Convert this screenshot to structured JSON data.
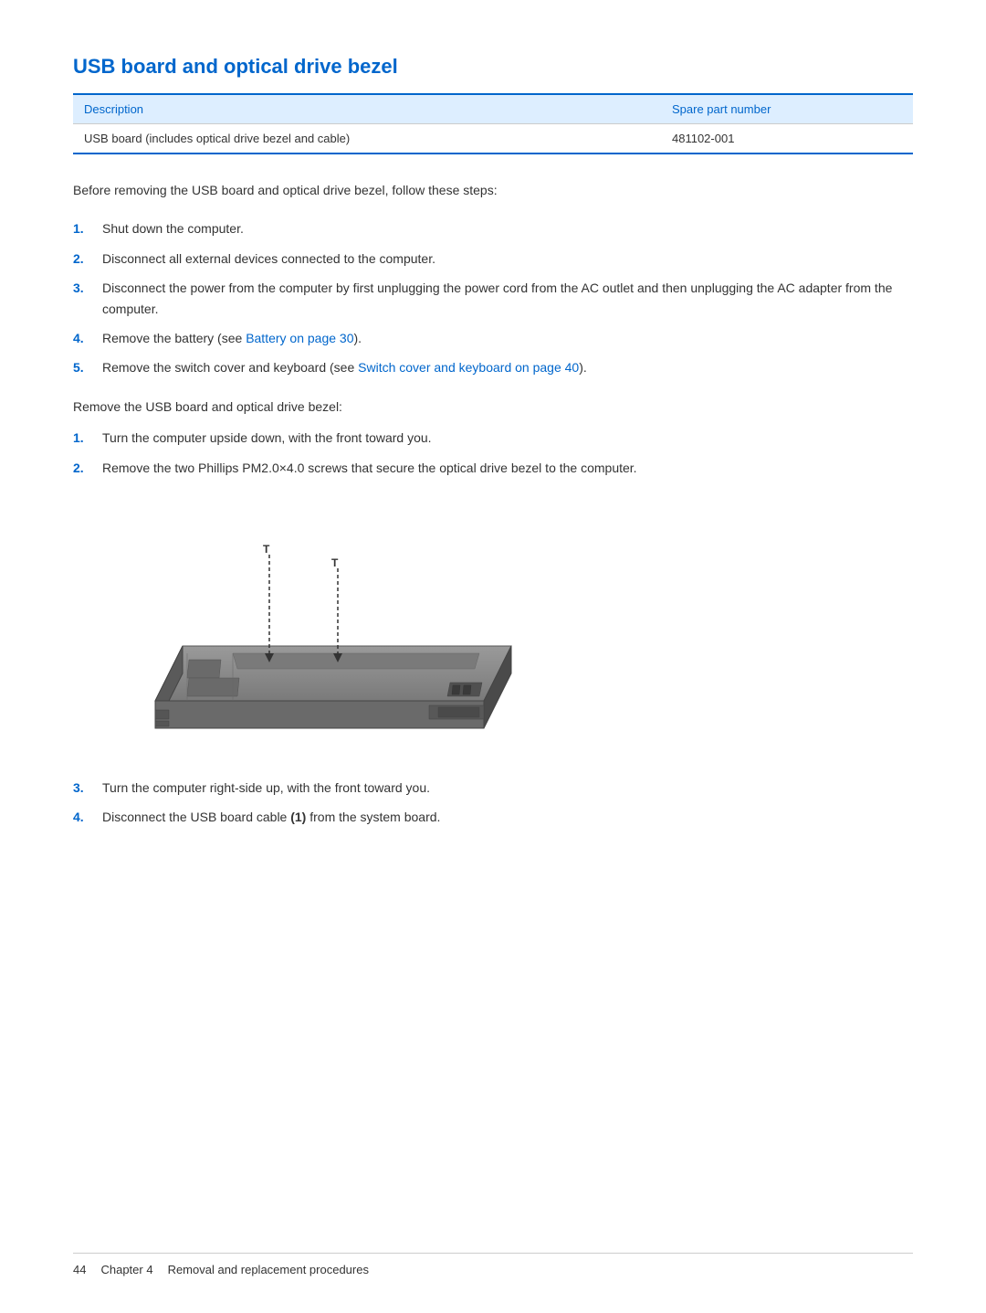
{
  "page": {
    "title": "USB board and optical drive bezel",
    "table": {
      "headers": {
        "description": "Description",
        "spare_part": "Spare part number"
      },
      "rows": [
        {
          "description": "USB board (includes optical drive bezel and cable)",
          "part_number": "481102-001"
        }
      ]
    },
    "intro": "Before removing the USB board and optical drive bezel, follow these steps:",
    "prereq_steps": [
      {
        "num": "1.",
        "text": "Shut down the computer."
      },
      {
        "num": "2.",
        "text": "Disconnect all external devices connected to the computer."
      },
      {
        "num": "3.",
        "text": "Disconnect the power from the computer by first unplugging the power cord from the AC outlet and then unplugging the AC adapter from the computer."
      },
      {
        "num": "4.",
        "text": "Remove the battery (see ",
        "link_text": "Battery on page 30",
        "link_href": "#battery-p30",
        "text_after": ")."
      },
      {
        "num": "5.",
        "text": "Remove the switch cover and keyboard (see ",
        "link_text": "Switch cover and keyboard on page 40",
        "link_href": "#switch-cover-p40",
        "text_after": ")."
      }
    ],
    "remove_label": "Remove the USB board and optical drive bezel:",
    "remove_steps": [
      {
        "num": "1.",
        "text": "Turn the computer upside down, with the front toward you."
      },
      {
        "num": "2.",
        "text": "Remove the two Phillips PM2.0×4.0 screws that secure the optical drive bezel to the computer."
      },
      {
        "num": "3.",
        "text": "Turn the computer right-side up, with the front toward you."
      },
      {
        "num": "4.",
        "text_before": "Disconnect the USB board cable ",
        "bold_text": "(1)",
        "text_after": " from the system board."
      }
    ],
    "footer": {
      "page_num": "44",
      "chapter": "Chapter 4",
      "chapter_title": "Removal and replacement procedures"
    }
  }
}
